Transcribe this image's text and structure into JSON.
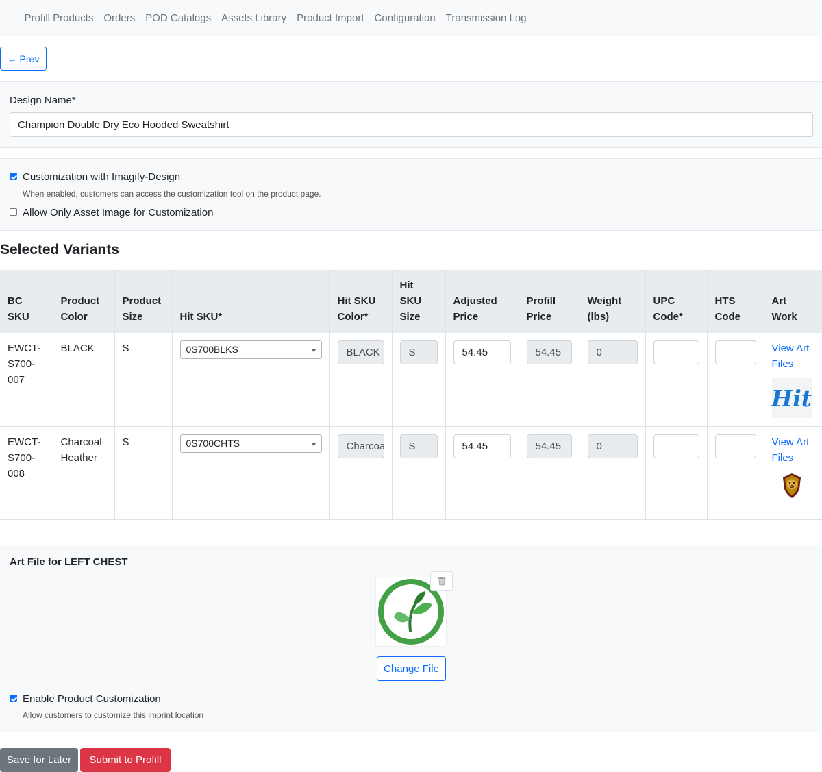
{
  "nav": {
    "items": [
      "Profill Products",
      "Orders",
      "POD Catalogs",
      "Assets Library",
      "Product Import",
      "Configuration",
      "Transmission Log"
    ]
  },
  "prev_button": "← Prev",
  "design": {
    "label": "Design Name*",
    "value": "Champion Double Dry Eco Hooded Sweatshirt"
  },
  "customization": {
    "imagify": {
      "label": "Customization with Imagify-Design",
      "checked": true,
      "help": "When enabled, customers can access the customization tool on the product page."
    },
    "asset_only": {
      "label": "Allow Only Asset Image for Customization",
      "checked": false
    }
  },
  "variants": {
    "title": "Selected Variants",
    "headers": {
      "bc_sku": "BC SKU",
      "product_color": "Product Color",
      "product_size": "Product Size",
      "hit_sku": "Hit SKU*",
      "hit_sku_color": "Hit SKU Color*",
      "hit_sku_size": "Hit SKU Size",
      "adjusted_price": "Adjusted Price",
      "profill_price": "Profill Price",
      "weight": "Weight (lbs)",
      "upc_code": "UPC Code*",
      "hts_code": "HTS Code",
      "art_work": "Art Work"
    },
    "rows": [
      {
        "bc_sku": "EWCT-S700-007",
        "product_color": "BLACK",
        "product_size": "S",
        "hit_sku": "0S700BLKS",
        "hit_sku_color": "BLACK",
        "hit_sku_size": "S",
        "adjusted_price": "54.45",
        "profill_price": "54.45",
        "weight": "0",
        "upc_code": "",
        "hts_code": "",
        "art_link": "View Art Files",
        "art_logo_text": "Hit",
        "art_icon": "hit-logo-icon"
      },
      {
        "bc_sku": "EWCT-S700-008",
        "product_color": "Charcoal Heather",
        "product_size": "S",
        "hit_sku": "0S700CHTS",
        "hit_sku_color": "Charcoal Heather",
        "hit_sku_size": "S",
        "adjusted_price": "54.45",
        "profill_price": "54.45",
        "weight": "0",
        "upc_code": "",
        "hts_code": "",
        "art_link": "View Art Files",
        "art_icon": "lion-crest-icon"
      }
    ]
  },
  "art_file": {
    "title": "Art File for LEFT CHEST",
    "image_icon": "leaf-circle-logo-icon",
    "change_button": "Change File",
    "enable": {
      "label": "Enable Product Customization",
      "checked": true,
      "help": "Allow customers to customize this imprint location"
    }
  },
  "actions": {
    "save": "Save for Later",
    "submit": "Submit to Profill"
  },
  "colors": {
    "primary": "#0d6efd",
    "danger": "#dc3545",
    "secondary": "#6c757d",
    "leaf_green": "#43a047"
  }
}
